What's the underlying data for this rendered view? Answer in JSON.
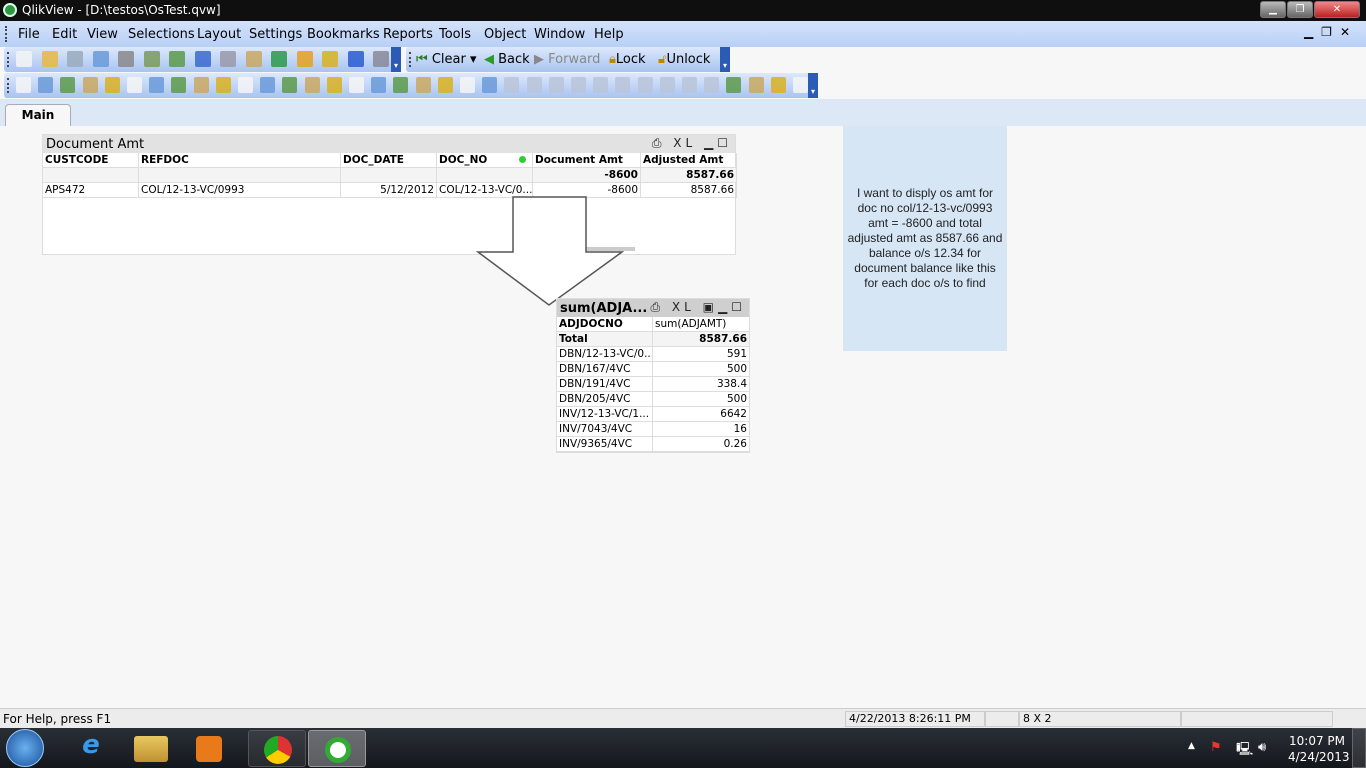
{
  "window": {
    "title": "QlikView - [D:\\testos\\OsTest.qvw]"
  },
  "menu": [
    "File",
    "Edit",
    "View",
    "Selections",
    "Layout",
    "Settings",
    "Bookmarks",
    "Reports",
    "Tools",
    "Object",
    "Window",
    "Help"
  ],
  "toolbar": {
    "clear": "Clear",
    "back": "Back",
    "forward": "Forward",
    "lock": "Lock",
    "unlock": "Unlock",
    "icons1": [
      "new-icon",
      "open-icon",
      "reload-icon",
      "save-icon",
      "print-icon",
      "edit-script-icon",
      "reload-data-icon",
      "undo-icon",
      "redo-icon",
      "search-icon",
      "checkbox-icon",
      "chart-icon",
      "star-icon",
      "help-icon",
      "context-help-icon"
    ],
    "icons2": [
      "new-sheet-icon",
      "promote-sheet-icon",
      "demote-sheet-icon",
      "sheet-properties-icon",
      "listbox-icon",
      "statistics-box-icon",
      "table-box-icon",
      "multi-box-icon",
      "chart-icon",
      "input-box-icon",
      "current-selections-icon",
      "button-icon",
      "text-object-icon",
      "line-arrow-icon",
      "slider-icon",
      "bookmark-object-icon",
      "search-object-icon",
      "container-icon",
      "custom-object-icon",
      "chart-wizard-icon",
      "format-painter-icon",
      "grid-icon",
      "align-left-icon",
      "align-center-icon",
      "align-right-icon",
      "align-bottom-icon",
      "align-middle-icon",
      "align-top-icon",
      "space-horizontal-icon",
      "space-vertical-icon",
      "adjust-left-icon",
      "adjust-top-icon",
      "user-icon",
      "document-properties-icon",
      "edit-icon",
      "object-tree-icon"
    ]
  },
  "tabs": [
    {
      "label": "Main"
    }
  ],
  "table1": {
    "title": "Document Amt",
    "columns": [
      "CUSTCODE",
      "REFDOC",
      "DOC_DATE",
      "DOC_NO",
      "Document Amt",
      "Adjusted Amt"
    ],
    "totals": [
      "",
      "",
      "",
      "",
      "-8600",
      "8587.66"
    ],
    "rows": [
      [
        "APS472",
        "COL/12-13-VC/0993",
        "5/12/2012",
        "COL/12-13-VC/0...",
        "-8600",
        "8587.66"
      ]
    ]
  },
  "table2": {
    "title": "sum(ADJA...",
    "columns": [
      "ADJDOCNO",
      "sum(ADJAMT)"
    ],
    "total": [
      "Total",
      "8587.66"
    ],
    "rows": [
      [
        "DBN/12-13-VC/0...",
        "591"
      ],
      [
        "DBN/167/4VC",
        "500"
      ],
      [
        "DBN/191/4VC",
        "338.4"
      ],
      [
        "DBN/205/4VC",
        "500"
      ],
      [
        "INV/12-13-VC/1...",
        "6642"
      ],
      [
        "INV/7043/4VC",
        "16"
      ],
      [
        "INV/9365/4VC",
        "0.26"
      ]
    ]
  },
  "caption_icons": {
    "print": "⎙",
    "xl": "XL",
    "min": "▁",
    "max": "☐"
  },
  "textbox": "I want to disply os amt  for doc no col/12-13-vc/0993 amt = -8600 and total adjusted amt as 8587.66 and balance o/s  12.34  for document balance like this for each doc o/s to find",
  "status": {
    "help": "For Help, press F1",
    "timestamp": "4/22/2013 8:26:11 PM",
    "dims": "8 X 2"
  },
  "taskbar": {
    "time": "10:07 PM",
    "date": "4/24/2013"
  }
}
